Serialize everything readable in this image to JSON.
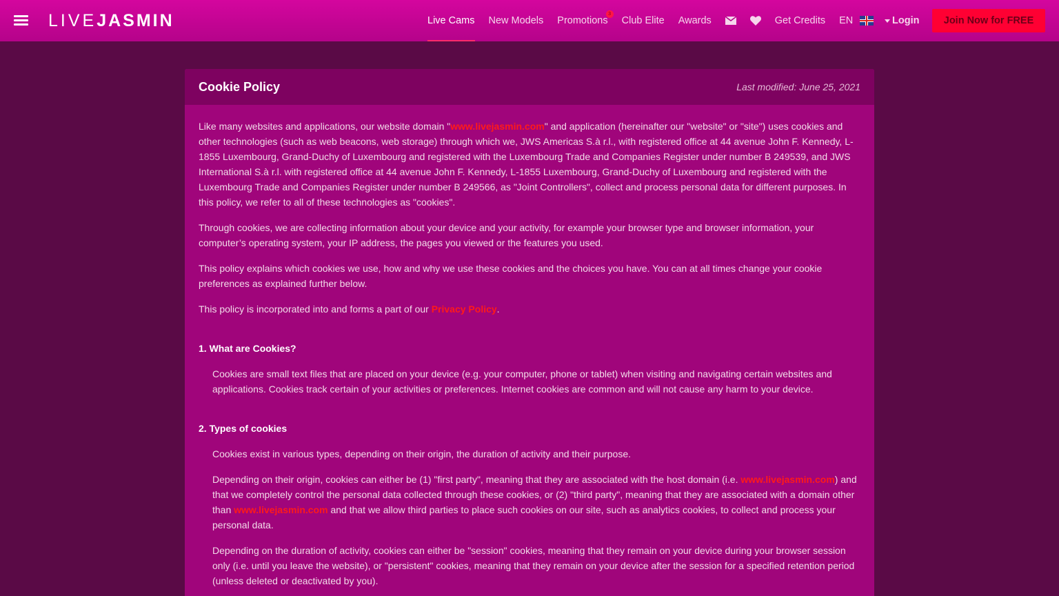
{
  "header": {
    "logo_light": "LIVE",
    "logo_bold": "JASMIN",
    "nav": {
      "live_cams": "Live Cams",
      "new_models": "New Models",
      "promotions": "Promotions",
      "promotions_badge": "3",
      "club_elite": "Club Elite",
      "awards": "Awards",
      "get_credits": "Get Credits"
    },
    "language": "EN",
    "login": "Login",
    "join": "Join Now for FREE"
  },
  "policy": {
    "title": "Cookie Policy",
    "last_modified": "Last modified: June 25, 2021",
    "intro": {
      "p1_a": "Like many websites and applications, our website domain \"",
      "p1_link": "www.livejasmin.com",
      "p1_b": "\" and application (hereinafter our \"website\" or \"site\") uses cookies and other technologies (such as web beacons, web storage) through which we, JWS Americas S.à r.l., with registered office at 44 avenue John F. Kennedy, L-1855 Luxembourg, Grand-Duchy of Luxembourg and registered with the Luxembourg Trade and Companies Register under number B 249539, and JWS International S.à r.l. with registered office at 44 avenue John F. Kennedy, L-1855 Luxembourg, Grand-Duchy of Luxembourg and registered with the Luxembourg Trade and Companies Register under number B 249566, as \"Joint Controllers\", collect and process personal data for different purposes. In this policy, we refer to all of these technologies as \"cookies\".",
      "p2": "Through cookies, we are collecting information about your device and your activity, for example your browser type and browser information, your computer’s operating system, your IP address, the pages you viewed or the features you used.",
      "p3": "This policy explains which cookies we use, how and why we use these cookies and the choices you have. You can at all times change your cookie preferences as explained further below.",
      "p4_a": "This policy is incorporated into and forms a part of our ",
      "p4_link": "Privacy Policy",
      "p4_b": "."
    },
    "section1": {
      "heading": "1. What are Cookies?",
      "p1": "Cookies are small text files that are placed on your device (e.g. your computer, phone or tablet) when visiting and navigating certain websites and applications. Cookies track certain of your activities or preferences. Internet cookies are common and will not cause any harm to your device."
    },
    "section2": {
      "heading": "2. Types of cookies",
      "p1": "Cookies exist in various types, depending on their origin, the duration of activity and their purpose.",
      "p2_a": "Depending on their origin, cookies can either be (1) \"first party\", meaning that they are associated with the host domain (i.e. ",
      "p2_link1": "www.livejasmin.com",
      "p2_b": ") and that we completely control the personal data collected through these cookies, or (2) \"third party\", meaning that they are associated with a domain other than ",
      "p2_link2": "www.livejasmin.com",
      "p2_c": " and that we allow third parties to place such cookies on our site, such as analytics cookies, to collect and process your personal data.",
      "p3": "Depending on the duration of activity, cookies can either be \"session\" cookies, meaning that they remain on your device during your browser session only (i.e. until you leave the website), or \"persistent\" cookies, meaning that they remain on your device after the session for a specified retention period (unless deleted or deactivated by you)."
    }
  }
}
